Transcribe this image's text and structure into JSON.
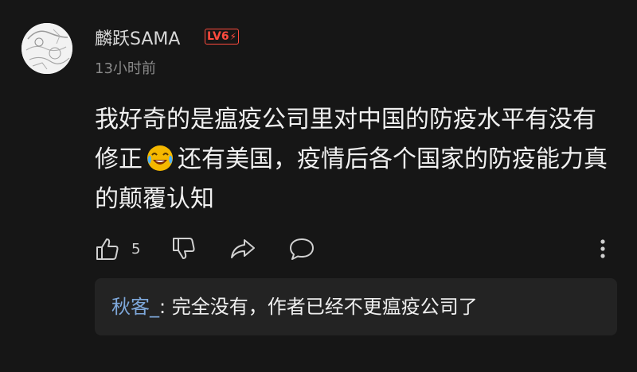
{
  "comment": {
    "username": "麟跃SAMA",
    "level_badge": "LV6",
    "time": "13小时前",
    "text_part1": "我好奇的是瘟疫公司里对中国的防疫水平有没有修正",
    "emoji_name": "laughing-crying-emoji",
    "text_part2": "还有美国，疫情后各个国家的防疫能力真的颠覆认知"
  },
  "actions": {
    "like_count": "5"
  },
  "reply": {
    "author": "秋客_",
    "separator": ": ",
    "text": "完全没有，作者已经不更瘟疫公司了"
  },
  "colors": {
    "background": "#161616",
    "level_badge": "#ff4b3e",
    "reply_author": "#7fa9dc",
    "reply_box": "#232323"
  }
}
